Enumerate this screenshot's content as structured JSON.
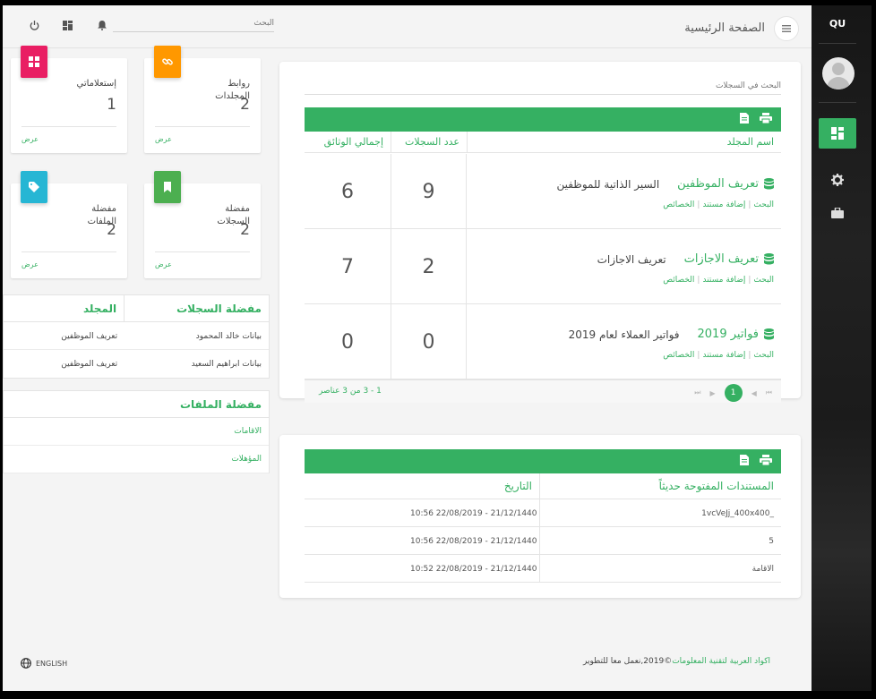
{
  "sidebar": {
    "brand": "QU"
  },
  "header": {
    "title": "الصفحة الرئيسية",
    "search_placeholder": "البحث"
  },
  "stats": [
    {
      "title_line1": "روابط",
      "title_line2": "المجلدات",
      "value": "2",
      "link": "عرض",
      "color": "#ff9800",
      "icon": "link-icon"
    },
    {
      "title_line1": "إستعلاماتي",
      "title_line2": "",
      "value": "1",
      "link": "عرض",
      "color": "#e91e63",
      "icon": "grid-icon"
    },
    {
      "title_line1": "مفضلة",
      "title_line2": "السجلات",
      "value": "2",
      "link": "عرض",
      "color": "#4caf50",
      "icon": "bookmark-icon"
    },
    {
      "title_line1": "مفضلة",
      "title_line2": "الملفات",
      "value": "2",
      "link": "عرض",
      "color": "#26b6d4",
      "icon": "tag-icon"
    }
  ],
  "fav_records": {
    "col1": "مفضلة السجلات",
    "col2": "المجلد",
    "rows": [
      {
        "name": "بيانات خالد المحمود",
        "folder": "تعريف الموظفين"
      },
      {
        "name": "بيانات ابراهيم السعيد",
        "folder": "تعريف الموظفين"
      }
    ]
  },
  "fav_files": {
    "title": "مفضلة الملفات",
    "rows": [
      "الاقامات",
      "المؤهلات"
    ]
  },
  "records": {
    "search_label": "البحث في السجلات",
    "headers": {
      "folder": "اسم المجلد",
      "count": "عدد السجلات",
      "total": "إجمالي الوثائق"
    },
    "rows": [
      {
        "name": "تعريف الموظفين",
        "desc": "السير الذاتية للموظفين",
        "count": "9",
        "total": "6"
      },
      {
        "name": "تعريف الاجازات",
        "desc": "تعريف الاجازات",
        "count": "2",
        "total": "7"
      },
      {
        "name": "فواتير 2019",
        "desc": "فواتير العملاء لعام 2019",
        "count": "0",
        "total": "0"
      }
    ],
    "actions": {
      "search": "البحث",
      "add": "إضافة مستند",
      "props": "الخصائص"
    },
    "pager": {
      "info": "1 - 3 من 3 عناصر",
      "current": "1"
    }
  },
  "recent": {
    "headers": {
      "name": "المستندات المفتوحة حديثاً",
      "date": "التاريخ"
    },
    "rows": [
      {
        "name": "1vcVeJj_400x400_",
        "date": "10:56 22/08/2019 - 21/12/1440"
      },
      {
        "name": "5",
        "date": "10:56 22/08/2019 - 21/12/1440"
      },
      {
        "name": "الاقامة",
        "date": "10:52 22/08/2019 - 21/12/1440"
      }
    ]
  },
  "footer": {
    "company": "اكواد العربية لتقنية المعلومات",
    "rest": "©2019,نعمل معا للتطوير",
    "lang": "ENGLISH"
  }
}
